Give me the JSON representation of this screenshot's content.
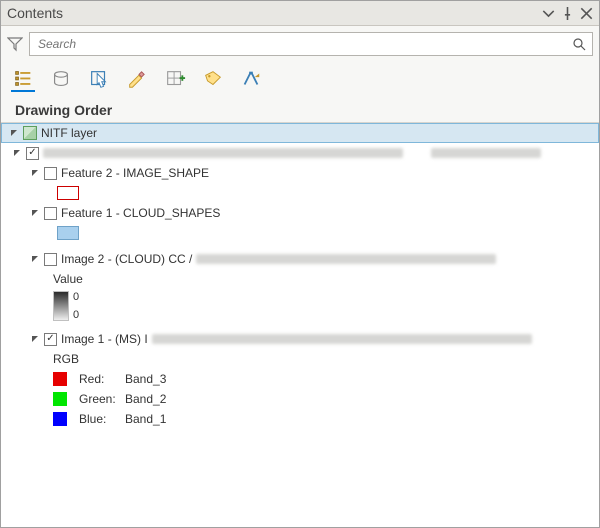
{
  "pane": {
    "title": "Contents"
  },
  "search": {
    "placeholder": "Search"
  },
  "section": {
    "drawing_order": "Drawing Order"
  },
  "toolbar": {
    "list_by_drawing_order": "List By Drawing Order",
    "list_by_source": "List By Data Source",
    "list_by_selection": "List By Selection",
    "list_by_editing": "List By Editing",
    "list_by_snapping": "List By Snapping",
    "list_by_labeling": "List By Labeling",
    "list_by_perspective": "List By Perspective Imagery"
  },
  "tree": {
    "root": {
      "label": "NITF layer"
    },
    "f2": {
      "label": "Feature 2 - IMAGE_SHAPE"
    },
    "f1": {
      "label": "Feature 1 - CLOUD_SHAPES"
    },
    "img2_prefix": "Image 2 - (CLOUD) CC / ",
    "img2_value_label": "Value",
    "img2_max": "0",
    "img2_min": "0",
    "img1_prefix": "Image 1 - (MS) I",
    "img1_composite": "RGB",
    "img1_red": {
      "channel": "Red:",
      "band": "Band_3"
    },
    "img1_green": {
      "channel": "Green:",
      "band": "Band_2"
    },
    "img1_blue": {
      "channel": "Blue:",
      "band": "Band_1"
    }
  }
}
